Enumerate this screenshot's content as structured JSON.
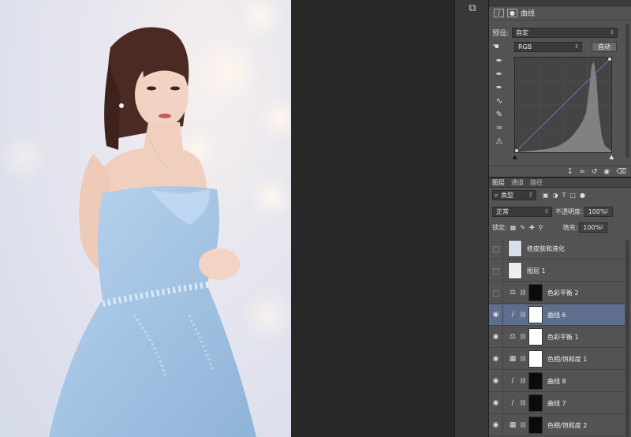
{
  "properties": {
    "panel_title": "曲线",
    "preset_label": "预设:",
    "preset_value": "自定",
    "channel_value": "RGB",
    "auto_button": "自动"
  },
  "layers_panel": {
    "tabs": [
      "图层",
      "通道",
      "路径"
    ],
    "filter_value": "类型",
    "blend_mode": "正常",
    "opacity_label": "不透明度:",
    "opacity_value": "100%",
    "lock_label": "锁定:",
    "fill_label": "填充:",
    "fill_value": "100%",
    "layers": [
      {
        "name": "修皮肤和液化",
        "visible": false,
        "kind": "pixel",
        "selected": false
      },
      {
        "name": "图层 1",
        "visible": false,
        "kind": "pixel",
        "selected": false
      },
      {
        "name": "色彩平衡 2",
        "visible": false,
        "kind": "balance",
        "selected": false
      },
      {
        "name": "曲线 6",
        "visible": true,
        "kind": "curve",
        "selected": true
      },
      {
        "name": "色彩平衡 1",
        "visible": true,
        "kind": "balance",
        "selected": false
      },
      {
        "name": "色相/饱和度 1",
        "visible": true,
        "kind": "hue",
        "selected": false
      },
      {
        "name": "曲线 8",
        "visible": true,
        "kind": "curve",
        "selected": false
      },
      {
        "name": "曲线 7",
        "visible": true,
        "kind": "curve",
        "selected": false
      },
      {
        "name": "色相/饱和度 2",
        "visible": true,
        "kind": "hue",
        "selected": false
      }
    ]
  },
  "colors": {
    "panel_bg": "#535353",
    "selected_row": "#5e6e8e",
    "dress": "#a9c7e4"
  }
}
